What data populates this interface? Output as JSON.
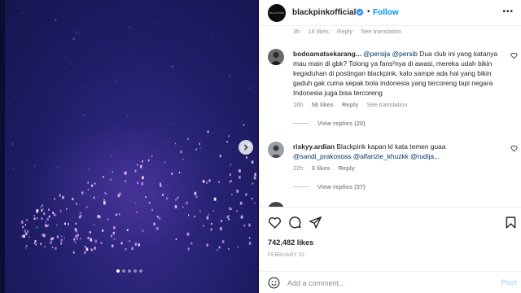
{
  "post": {
    "username": "blackpinkofficial",
    "avatar_text": "BLACKPINK",
    "separator": "•",
    "follow_label": "Follow",
    "more_label": "•••",
    "accent_color": "#0095f6"
  },
  "media": {
    "dots_count": 5,
    "active_dot": 1
  },
  "top_meta": {
    "time": "3h",
    "likes": "16 likes",
    "reply": "Reply",
    "translation": "See translation"
  },
  "comments": [
    {
      "username": "bodoamatsekarang...",
      "text_before": " ",
      "mentions": [
        "@persija",
        "@persib"
      ],
      "text": " Dua club ini yang katanya mau main di gbk? Tolong ya fans²nya di awasi, mereka udah bikin kegaduhan di postingan blackpink, kalo sampe ada hal yang bikin gaduh gak cuma sepak bola indonesia yang tercoreng tapi negara Indonesia juga bisa tercoreng",
      "time": "16h",
      "likes": "58 likes",
      "reply": "Reply",
      "translation": "See translation",
      "view_replies": "View replies (20)"
    },
    {
      "username": "riskyy.ardian",
      "text": " Blackpink kapan kl kata temen guaa",
      "mentions": [
        "@sandi_prakososs",
        "@alfarizie_khuzkk",
        "@rudija..."
      ],
      "time": "22h",
      "likes": "3 likes",
      "reply": "Reply",
      "view_replies": "View replies (37)"
    }
  ],
  "actions": {
    "likes_count": "742,482 likes",
    "date": "FEBRUARY 22"
  },
  "add_comment": {
    "placeholder": "Add a comment...",
    "post_label": "Post"
  }
}
